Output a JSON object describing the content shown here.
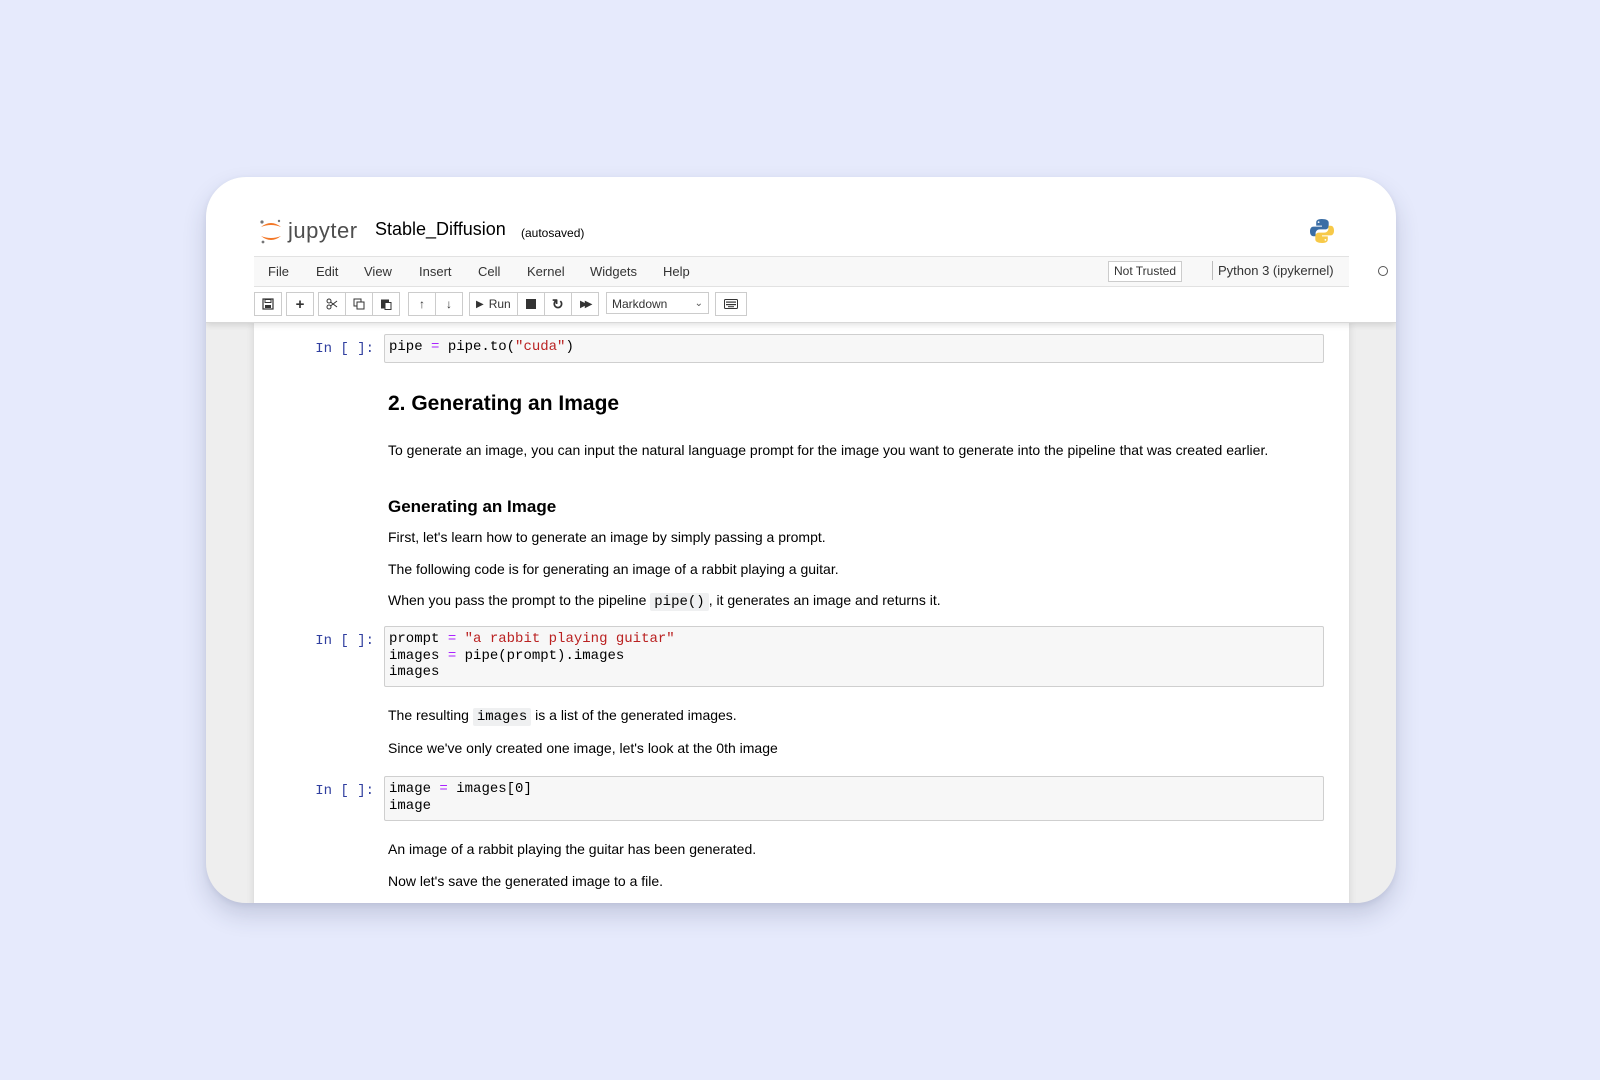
{
  "header": {
    "logo_text": "jupyter",
    "notebook_title": "Stable_Diffusion",
    "autosave_status": "(autosaved)"
  },
  "menu": {
    "items": [
      "File",
      "Edit",
      "View",
      "Insert",
      "Cell",
      "Kernel",
      "Widgets",
      "Help"
    ],
    "trust_status": "Not Trusted",
    "kernel_name": "Python 3 (ipykernel)"
  },
  "toolbar": {
    "run_label": "Run",
    "cell_type": "Markdown"
  },
  "cells": {
    "c1": {
      "prompt": "In [ ]:",
      "code_var": "pipe",
      "code_op": "=",
      "code_rest": "pipe.to(",
      "code_str": "\"cuda\"",
      "code_end": ")"
    },
    "h_generating": "2. Generating an Image",
    "p_intro": "To generate an image, you can input the natural language prompt for the image you want to generate into the pipeline that was created earlier.",
    "h_sub": "Generating an Image",
    "p_first": "First, let's learn how to generate an image by simply passing a prompt.",
    "p_following": "The following code is for generating an image of a rabbit playing a guitar.",
    "p_pass_before": "When you pass the prompt to the pipeline ",
    "p_pass_code": "pipe()",
    "p_pass_after": ", it generates an image and returns it.",
    "c2": {
      "prompt": "In [ ]:",
      "l1_var": "prompt",
      "l1_op": "=",
      "l1_str": "\"a rabbit playing guitar\"",
      "l2_var": "images",
      "l2_op": "=",
      "l2_rest": "pipe(prompt).images",
      "l3": "images"
    },
    "p_result_before": "The resulting ",
    "p_result_code": "images",
    "p_result_after": " is a list of the generated images.",
    "p_since": "Since we've only created one image, let's look at the 0th image",
    "c3": {
      "prompt": "In [ ]:",
      "l1_var": "image",
      "l1_op": "=",
      "l1_rest": "images[0]",
      "l2": "image"
    },
    "p_generated": "An image of a rabbit playing the guitar has been generated.",
    "p_save": "Now let's save the generated image to a file."
  },
  "colors": {
    "page_bg": "#e6eafc",
    "prompt": "#303f9f",
    "operator": "#aa22ff",
    "string": "#ba2121",
    "jupyter_orange": "#f37726"
  }
}
